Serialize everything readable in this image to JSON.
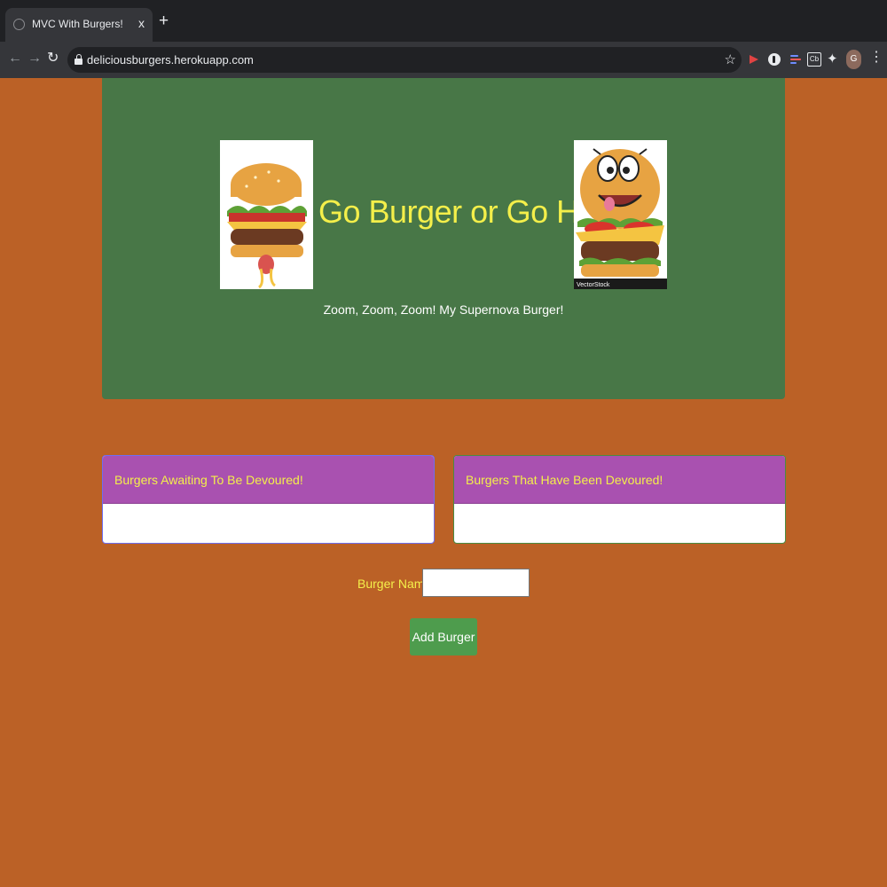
{
  "browser": {
    "tab": {
      "title": "MVC With Burgers!",
      "close": "x",
      "new_tab": "+"
    },
    "nav": {
      "back": "←",
      "forward": "→",
      "reload": "↻"
    },
    "address": {
      "url": "deliciousburgers.herokuapp.com",
      "bookmark": "☆"
    },
    "extensions": {
      "puzzle": "✦",
      "cb_label": "Cb"
    },
    "profile_initial": "G",
    "menu": "⋮"
  },
  "hero": {
    "title": "Go Burger or Go Home!",
    "subtitle": "Zoom, Zoom, Zoom! My Supernova Burger!",
    "watermark": "VectorStock"
  },
  "panels": {
    "awaiting": {
      "header": "Burgers Awaiting To Be Devoured!",
      "items": []
    },
    "devoured": {
      "header": "Burgers That Have Been Devoured!",
      "items": []
    }
  },
  "form": {
    "label": "Burger Name:",
    "value": "",
    "placeholder": "",
    "submit": "Add Burger"
  },
  "colors": {
    "page_bg": "#bb6126",
    "jumbotron_bg": "#487747",
    "headline": "#f4ef4a",
    "card_header_bg": "#a951b0",
    "button_bg": "#4e9c4d"
  }
}
